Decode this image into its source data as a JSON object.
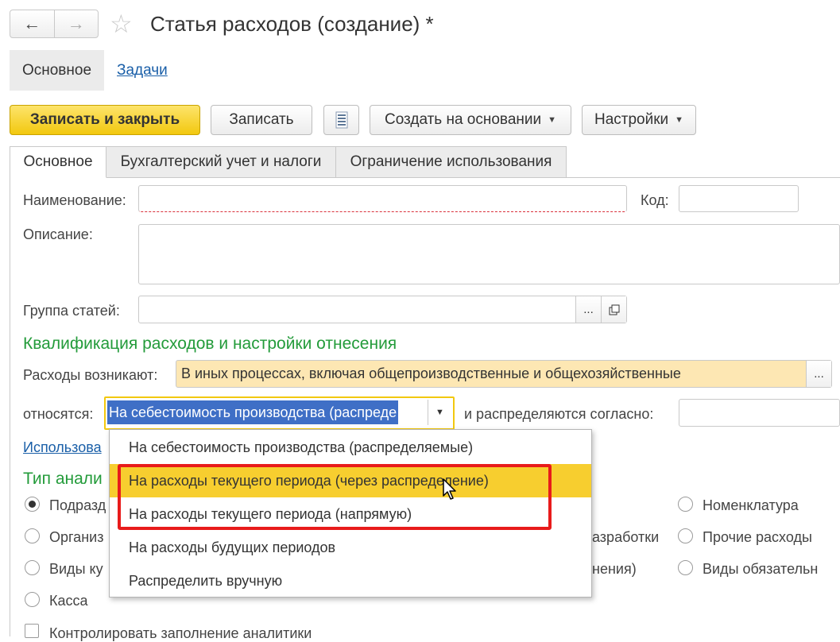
{
  "window": {
    "back_icon": "arrow-left-icon",
    "forward_icon": "arrow-right-icon",
    "favorite_icon": "star-icon",
    "title": "Статья расходов (создание) *"
  },
  "sections": {
    "main": "Основное",
    "tasks": "Задачи"
  },
  "toolbar": {
    "save_close": "Записать и закрыть",
    "save": "Записать",
    "list_icon": "document-list-icon",
    "create_based": "Создать на основании",
    "settings": "Настройки"
  },
  "tabs": [
    "Основное",
    "Бухгалтерский учет и налоги",
    "Ограничение использования"
  ],
  "form": {
    "name_label": "Наименование:",
    "name_value": "",
    "code_label": "Код:",
    "code_value": "",
    "description_label": "Описание:",
    "description_value": "",
    "group_label": "Группа статей:",
    "group_value": "",
    "group_choose": "...",
    "group_open_icon": "open-window-icon"
  },
  "qualification": {
    "heading": "Квалификация расходов и настройки отнесения",
    "arise_label": "Расходы возникают:",
    "arise_value": "В иных процессах, включая общепроизводственные и общехозяйственные",
    "arise_choose": "...",
    "attribute_label": "относятся:",
    "attribute_value": "На себестоимость производства (распреде",
    "dropdown_icon": "chevron-down-icon",
    "distributed_label": "и распределяются согласно:",
    "distributed_value": "",
    "usage_link": "Использова"
  },
  "analytics": {
    "heading": "Тип анали",
    "left_options": [
      {
        "label": "Подразд",
        "checked": true
      },
      {
        "label": "Организ",
        "checked": false
      },
      {
        "label": "Виды ку",
        "checked": false
      },
      {
        "label": "Касса",
        "checked": false
      }
    ],
    "middle_fragments": [
      "азработки",
      "нения)"
    ],
    "right_options": [
      {
        "label": "Номенклатура",
        "checked": false
      },
      {
        "label": "Прочие расходы",
        "checked": false
      },
      {
        "label": "Виды обязательн",
        "checked": false
      }
    ],
    "control_label": "Контролировать заполнение аналитики",
    "control_checked": false
  },
  "dropdown": {
    "items": [
      "На себестоимость производства (распределяемые)",
      "На расходы текущего периода (через распределение)",
      "На расходы текущего периода (напрямую)",
      "На расходы будущих периодов",
      "Распределить вручную"
    ],
    "highlighted_index": 1
  },
  "colors": {
    "primary_button": "#f2c80f",
    "heading_green": "#239b3a",
    "link_blue": "#1a5fa8",
    "highlight_yellow": "#f7ce2f",
    "annotation_red": "#e81b1b",
    "arise_field_bg": "#fde7b3"
  }
}
